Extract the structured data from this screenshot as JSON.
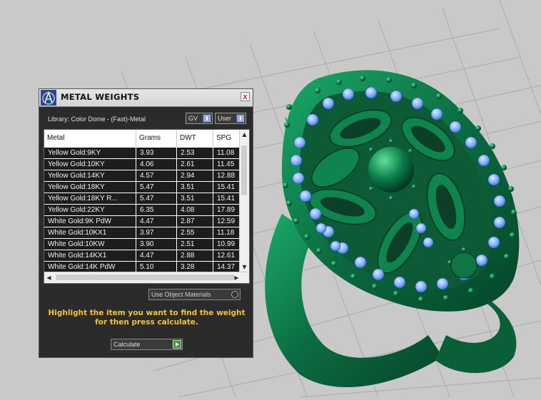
{
  "viewport": {
    "background_color": "#c9c9c9",
    "grid_color": "#a9a9a9",
    "model_color": "#0b7a4a",
    "gem_color": "#7fb2ff"
  },
  "panel": {
    "title": "METAL WEIGHTS",
    "close_label": "x",
    "library_label": "Library: Color Dome - (Fast)-Metal",
    "gv_label": "GV",
    "user_label": "User",
    "use_object_label": "Use Object Materials",
    "instructions": "Highlight the item you want to find the weight for then press calculate.",
    "calculate_label": "Calculate"
  },
  "table": {
    "columns": [
      "Metal",
      "Grams",
      "DWT",
      "SPG"
    ],
    "rows": [
      [
        "Yellow Gold:9KY",
        "3.93",
        "2.53",
        "11.08"
      ],
      [
        "Yellow Gold:10KY",
        "4.06",
        "2.61",
        "11.45"
      ],
      [
        "Yellow Gold:14KY",
        "4.57",
        "2.94",
        "12.88"
      ],
      [
        "Yellow Gold:18KY",
        "5.47",
        "3.51",
        "15.41"
      ],
      [
        "Yellow Gold:18KY R...",
        "5.47",
        "3.51",
        "15.41"
      ],
      [
        "Yellow Gold:22KY",
        "6.35",
        "4.08",
        "17.89"
      ],
      [
        "White Gold:9K PdW",
        "4.47",
        "2.87",
        "12.59"
      ],
      [
        "White Gold:10KX1",
        "3.97",
        "2.55",
        "11.18"
      ],
      [
        "White Gold:10KW",
        "3.90",
        "2.51",
        "10.99"
      ],
      [
        "White Gold:14KX1",
        "4.47",
        "2.88",
        "12.61"
      ],
      [
        "White Gold:14K PdW",
        "5.10",
        "3.28",
        "14.37"
      ]
    ]
  },
  "icons": {
    "logo": "software-logo-icon",
    "close": "close-icon",
    "calculate": "play-arrow-icon"
  }
}
